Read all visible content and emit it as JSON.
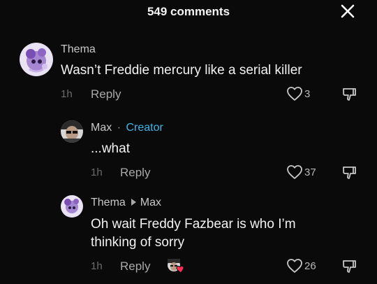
{
  "header": {
    "title": "549 comments"
  },
  "comments": [
    {
      "author": "Thema",
      "text": "Wasn’t Freddie mercury like a serial killer",
      "time": "1h",
      "reply_label": "Reply",
      "likes": "3"
    },
    {
      "author": "Max",
      "separator": "·",
      "badge": "Creator",
      "text": "...what",
      "time": "1h",
      "reply_label": "Reply",
      "likes": "37"
    },
    {
      "author": "Thema",
      "reply_to": "Max",
      "text_line1": "Oh wait Freddy Fazbear is who I’m",
      "text_line2": "thinking of sorry",
      "time": "1h",
      "reply_label": "Reply",
      "likes": "26"
    }
  ],
  "colors": {
    "background": "#0a0a0a",
    "creator_badge": "#3fb5e8",
    "liked_by_creator_heart": "#ff2d55"
  },
  "icons": [
    "close-icon",
    "heart-outline-icon",
    "dislike-icon",
    "liked-by-creator-icon"
  ]
}
